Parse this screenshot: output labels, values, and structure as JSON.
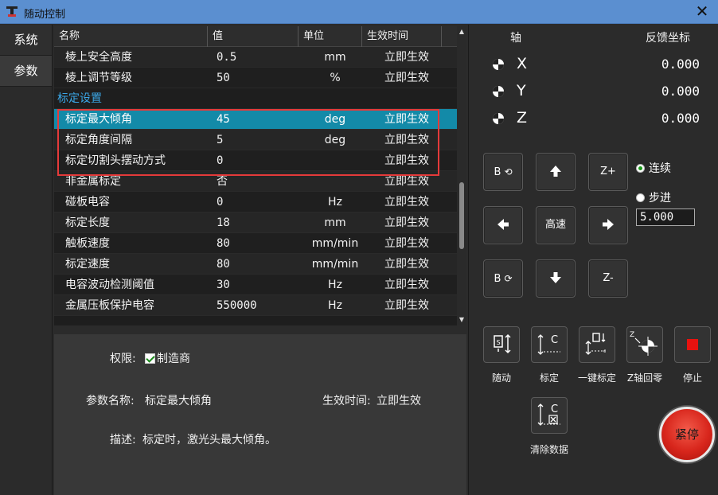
{
  "window": {
    "title": "随动控制",
    "close_label": "✕"
  },
  "sidebar": {
    "items": [
      {
        "label": "系统"
      },
      {
        "label": "参数"
      }
    ]
  },
  "table": {
    "columns": [
      "名称",
      "值",
      "单位",
      "生效时间"
    ],
    "rows": [
      {
        "name": "棱上安全高度",
        "value": "0.5",
        "unit": "mm",
        "effect": "立即生效"
      },
      {
        "name": "棱上调节等级",
        "value": "50",
        "unit": "%",
        "effect": "立即生效"
      },
      {
        "group": "标定设置"
      },
      {
        "name": "标定最大倾角",
        "value": "45",
        "unit": "deg",
        "effect": "立即生效",
        "selected": true
      },
      {
        "name": "标定角度间隔",
        "value": "5",
        "unit": "deg",
        "effect": "立即生效"
      },
      {
        "name": "标定切割头摆动方式",
        "value": "0",
        "unit": "",
        "effect": "立即生效"
      },
      {
        "name": "非金属标定",
        "value": "否",
        "unit": "",
        "effect": "立即生效"
      },
      {
        "name": "碰板电容",
        "value": "0",
        "unit": "Hz",
        "effect": "立即生效"
      },
      {
        "name": "标定长度",
        "value": "18",
        "unit": "mm",
        "effect": "立即生效"
      },
      {
        "name": "触板速度",
        "value": "80",
        "unit": "mm/min",
        "effect": "立即生效"
      },
      {
        "name": "标定速度",
        "value": "80",
        "unit": "mm/min",
        "effect": "立即生效"
      },
      {
        "name": "电容波动检测阈值",
        "value": "30",
        "unit": "Hz",
        "effect": "立即生效"
      },
      {
        "name": "金属压板保护电容",
        "value": "550000",
        "unit": "Hz",
        "effect": "立即生效"
      }
    ]
  },
  "info": {
    "permission_label": "权限:",
    "permission_value": "制造商",
    "param_name_label": "参数名称:",
    "param_name_value": "标定最大倾角",
    "effect_label": "生效时间:",
    "effect_value": "立即生效",
    "desc_label": "描述:",
    "desc_value": "标定时，激光头最大倾角。"
  },
  "axes": {
    "header_axis": "轴",
    "header_feedback": "反馈坐标",
    "items": [
      {
        "name": "X",
        "value": "0.000"
      },
      {
        "name": "Y",
        "value": "0.000"
      },
      {
        "name": "Z",
        "value": "0.000"
      }
    ]
  },
  "jog": {
    "b_ccw": "B",
    "z_plus": "Z+",
    "speed": "高速",
    "b_cw": "B",
    "z_minus": "Z-",
    "mode_continuous": "连续",
    "mode_step": "步进",
    "step_value": "5.000"
  },
  "functions": {
    "follow": "随动",
    "calibrate": "标定",
    "one_key_calibrate": "一键标定",
    "z_home": "Z轴回零",
    "stop": "停止",
    "clear_data": "清除数据",
    "estop": "紧停"
  },
  "colors": {
    "accent": "#138aa8",
    "group_text": "#3ba6e6",
    "highlight_border": "#e53a3a",
    "estop": "#d8261c"
  }
}
